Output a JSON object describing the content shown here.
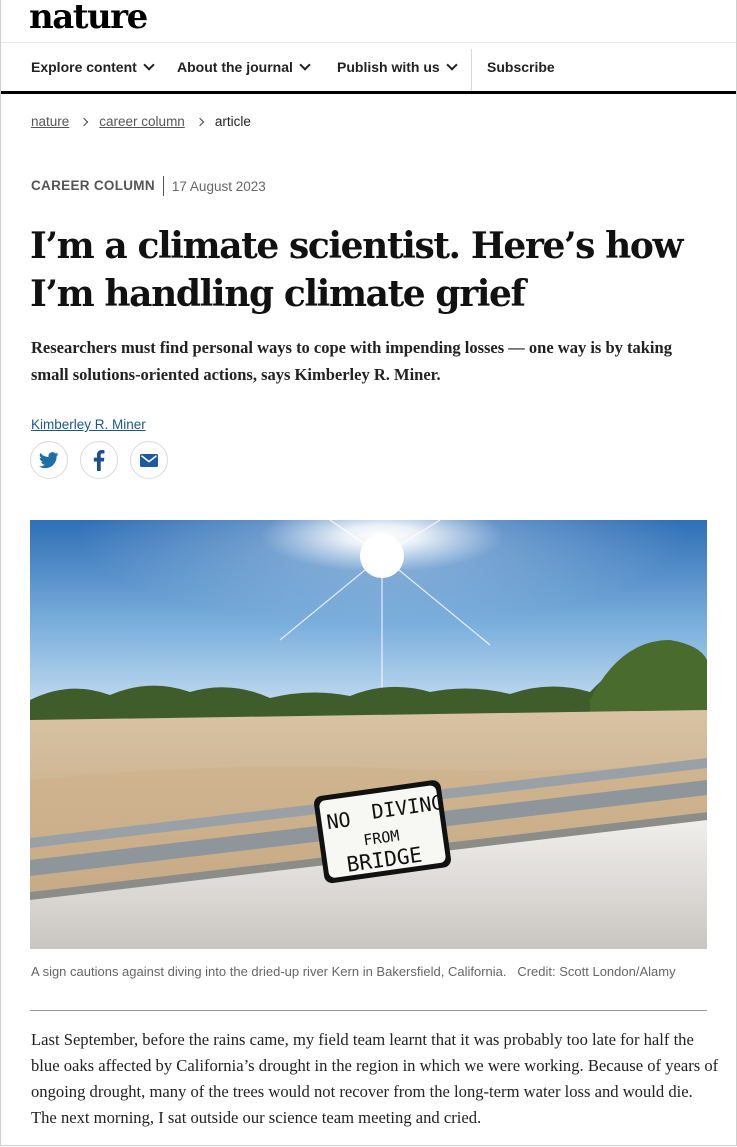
{
  "site": {
    "logo": "nature"
  },
  "nav": {
    "items": [
      {
        "label": "Explore content",
        "has_menu": true
      },
      {
        "label": "About the journal",
        "has_menu": true
      },
      {
        "label": "Publish with us",
        "has_menu": true
      }
    ],
    "subscribe": "Subscribe"
  },
  "breadcrumb": {
    "items": [
      "nature",
      "career column",
      "article"
    ]
  },
  "article": {
    "type": "CAREER COLUMN",
    "date": "17 August 2023",
    "title": "I’m a climate scientist. Here’s how I’m handling climate grief",
    "standfirst": "Researchers must find personal ways to cope with impending losses — one way is by taking small solutions-oriented actions, says Kimberley R. Miner.",
    "author": "Kimberley R. Miner",
    "share_icons": [
      "twitter-icon",
      "facebook-icon",
      "email-icon"
    ],
    "figure": {
      "sign_lines": [
        "NO",
        "DIVING",
        "FROM",
        "BRIDGE"
      ],
      "caption": "A sign cautions against diving into the dried-up river Kern in Bakersfield, California.",
      "credit": "Credit: Scott London/Alamy"
    },
    "paragraph_1": "Last September, before the rains came, my field team learnt that it was probably too late for half the blue oaks affected by California’s drought in the region in which we were working. Because of years of ongoing drought, many of the trees would not recover from the long-term water loss and would die. The next morning, I sat outside our science team meeting and cried."
  },
  "colors": {
    "link": "#1a5a8a",
    "twitter": "#1d6fa5",
    "facebook": "#1d4f91",
    "email": "#1d5aa0"
  }
}
